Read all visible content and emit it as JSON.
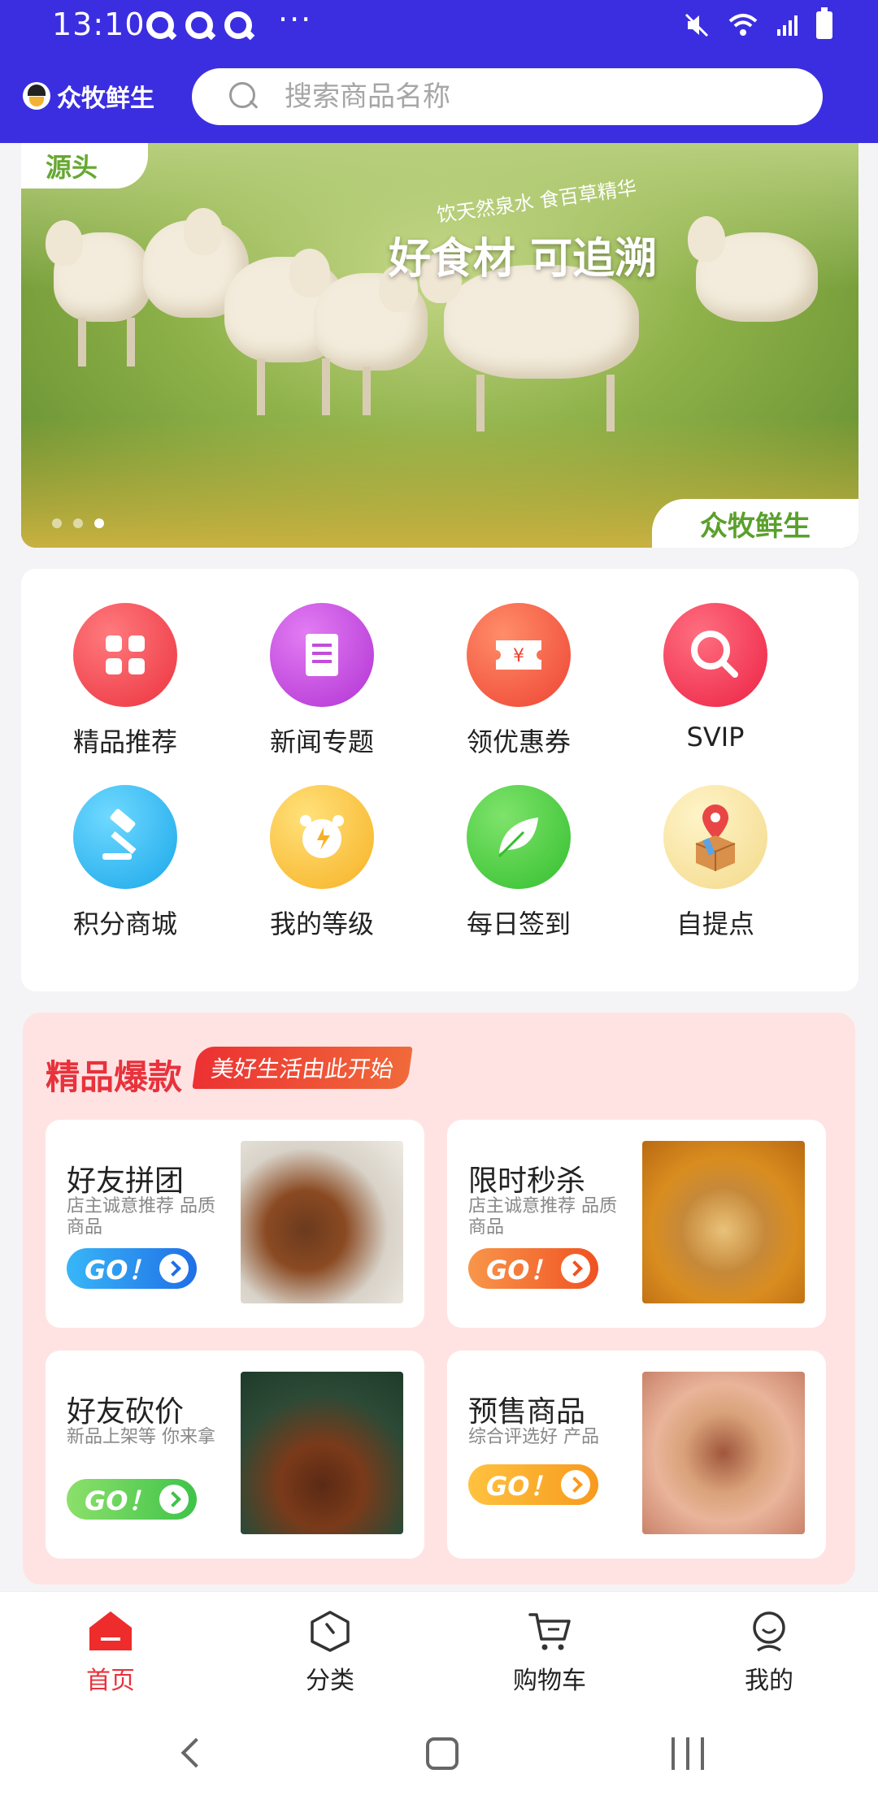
{
  "status_bar": {
    "time": "13:10",
    "more": "···"
  },
  "app_bar": {
    "brand_name": "众牧鲜生",
    "search_placeholder": "搜索商品名称"
  },
  "banner": {
    "tag_source": "源头",
    "slogan_small": "饮天然泉水 食百草精华",
    "slogan_big": "好食材 可追溯",
    "brand_tag": "众牧鲜生",
    "page_count": 3,
    "active_page": 3
  },
  "grid": {
    "items": [
      {
        "label": "精品推荐",
        "icon": "grid-icon",
        "color": "#f0444f"
      },
      {
        "label": "新闻专题",
        "icon": "document-icon",
        "color": "#c54bdc"
      },
      {
        "label": "领优惠券",
        "icon": "coupon-icon",
        "color": "#f45a3e"
      },
      {
        "label": "SVIP",
        "icon": "magnifier-icon",
        "color": "#f2384f"
      },
      {
        "label": "积分商城",
        "icon": "gavel-icon",
        "color": "#2eb8f0"
      },
      {
        "label": "我的等级",
        "icon": "alarm-clock-icon",
        "color": "#f9c23a"
      },
      {
        "label": "每日签到",
        "icon": "leaf-icon",
        "color": "#4ccd3c"
      },
      {
        "label": "自提点",
        "icon": "location-package-icon",
        "color": "#f5e6a0"
      }
    ]
  },
  "hot": {
    "title": "精品爆款",
    "badge": "美好生活由此开始",
    "go_label": "GO！",
    "deals": [
      {
        "title": "好友拼团",
        "subtitle": "店主诚意推荐 品质商品",
        "go_color": "#2a86ef"
      },
      {
        "title": "限时秒杀",
        "subtitle": "店主诚意推荐 品质商品",
        "go_color": "#f56a2e"
      },
      {
        "title": "好友砍价",
        "subtitle": "新品上架等 你来拿",
        "go_color": "#5ccb54"
      },
      {
        "title": "预售商品",
        "subtitle": "综合评选好 产品",
        "go_color": "#f7a728"
      }
    ]
  },
  "tabs": {
    "items": [
      {
        "label": "首页",
        "icon": "home-icon"
      },
      {
        "label": "分类",
        "icon": "category-icon"
      },
      {
        "label": "购物车",
        "icon": "cart-icon"
      },
      {
        "label": "我的",
        "icon": "profile-icon"
      }
    ],
    "active_color": "#e8323c"
  }
}
